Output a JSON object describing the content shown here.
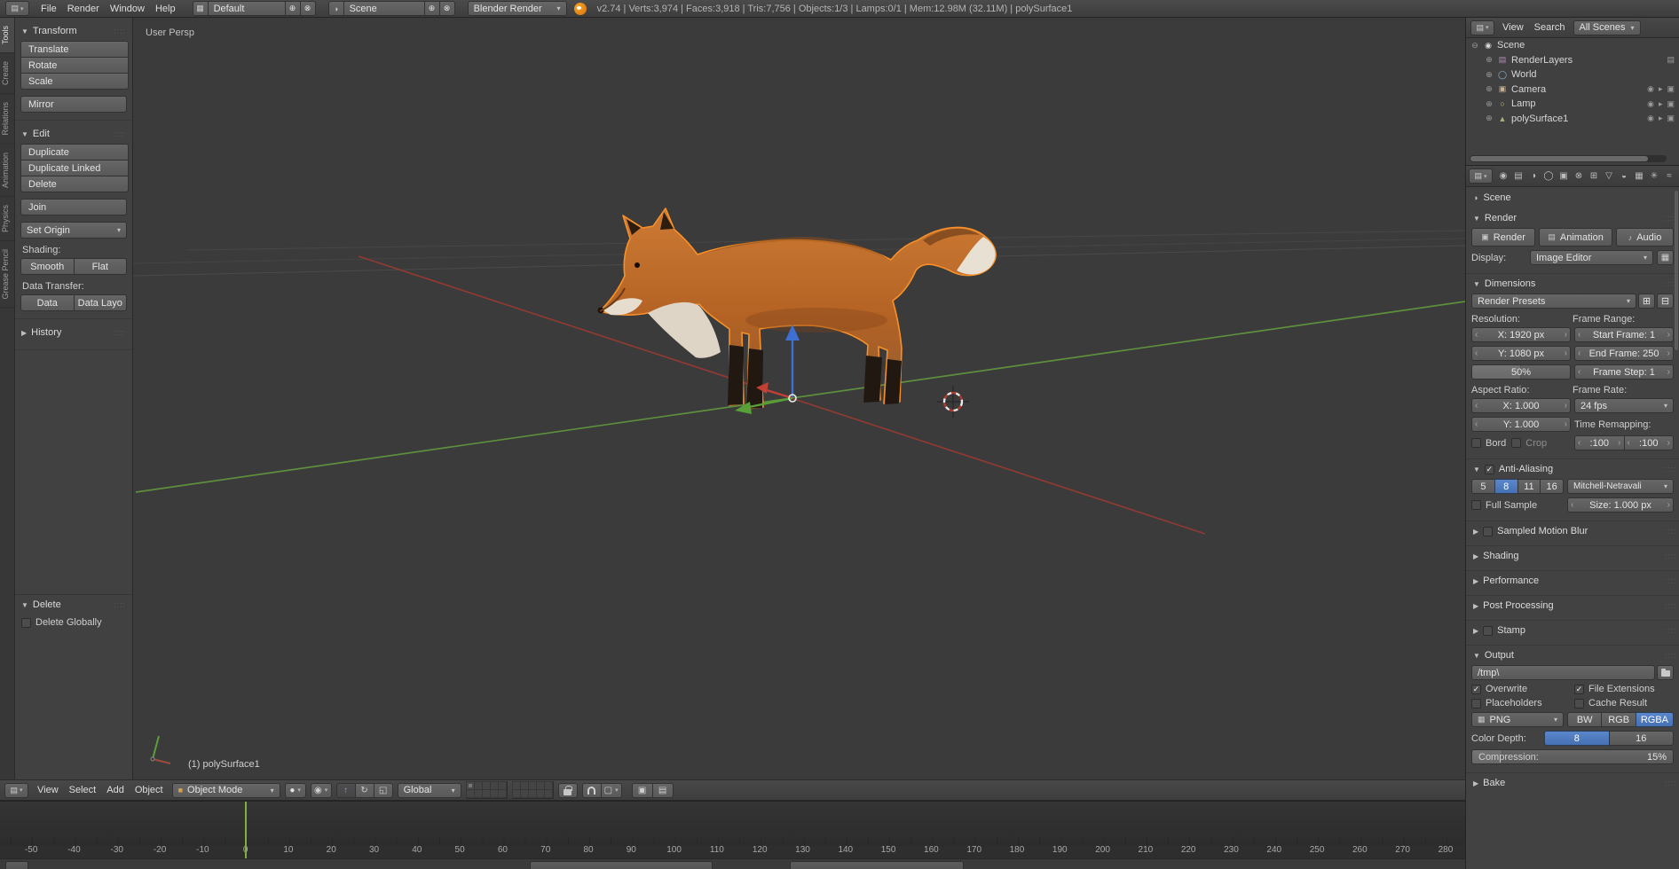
{
  "top_header": {
    "menus": [
      "File",
      "Render",
      "Window",
      "Help"
    ],
    "screen_layout": "Default",
    "scene_name": "Scene",
    "engine": "Blender Render",
    "stats": "v2.74 | Verts:3,974 | Faces:3,918 | Tris:7,756 | Objects:1/3 | Lamps:0/1 | Mem:12.98M (32.11M) | polySurface1"
  },
  "tool_shelf": {
    "tabs": [
      "Tools",
      "Create",
      "Relations",
      "Animation",
      "Physics",
      "Grease Pencil"
    ],
    "transform_title": "Transform",
    "transform_buttons": [
      "Translate",
      "Rotate",
      "Scale"
    ],
    "mirror": "Mirror",
    "edit_title": "Edit",
    "edit_buttons": [
      "Duplicate",
      "Duplicate Linked",
      "Delete"
    ],
    "join": "Join",
    "set_origin": "Set Origin",
    "shading_label": "Shading:",
    "smooth": "Smooth",
    "flat": "Flat",
    "data_transfer_label": "Data Transfer:",
    "data": "Data",
    "data_layout": "Data Layo",
    "history_title": "History",
    "operator_title": "Delete",
    "operator_option": "Delete Globally"
  },
  "viewport": {
    "view_label": "User Persp",
    "status_label": "(1) polySurface1"
  },
  "viewport_header": {
    "menus": [
      "View",
      "Select",
      "Add",
      "Object"
    ],
    "mode": "Object Mode",
    "orientation": "Global"
  },
  "timeline": {
    "ticks": [
      "-50",
      "-40",
      "-30",
      "-20",
      "-10",
      "0",
      "10",
      "20",
      "30",
      "40",
      "50",
      "60",
      "70",
      "80",
      "90",
      "100",
      "110",
      "120",
      "130",
      "140",
      "150",
      "160",
      "170",
      "180",
      "190",
      "200",
      "210",
      "220",
      "230",
      "240",
      "250",
      "260",
      "270",
      "280"
    ],
    "current_frame": 0
  },
  "outliner": {
    "menus": [
      "View",
      "Search"
    ],
    "display_filter": "All Scenes",
    "tree": [
      {
        "label": "Scene"
      },
      {
        "label": "RenderLayers"
      },
      {
        "label": "World"
      },
      {
        "label": "Camera"
      },
      {
        "label": "Lamp"
      },
      {
        "label": "polySurface1"
      }
    ]
  },
  "properties": {
    "context_name": "Scene",
    "render_title": "Render",
    "render_button": "Render",
    "animation_button": "Animation",
    "audio_button": "Audio",
    "display_label": "Display:",
    "display_value": "Image Editor",
    "dimensions_title": "Dimensions",
    "render_presets": "Render Presets",
    "resolution_label": "Resolution:",
    "frame_range_label": "Frame Range:",
    "res_x": "X: 1920 px",
    "res_y": "Y: 1080 px",
    "res_scale": "50%",
    "start_frame": "Start Frame: 1",
    "end_frame": "End Frame: 250",
    "frame_step": "Frame Step: 1",
    "aspect_label": "Aspect Ratio:",
    "frame_rate_label": "Frame Rate:",
    "aspect_x": "X: 1.000",
    "aspect_y": "Y: 1.000",
    "fps": "24 fps",
    "time_remap_label": "Time Remapping:",
    "remap_old": ":100",
    "remap_new": ":100",
    "border": "Bord",
    "crop": "Crop",
    "aa_title": "Anti-Aliasing",
    "aa_samples": [
      "5",
      "8",
      "11",
      "16"
    ],
    "aa_filter": "Mitchell-Netravali",
    "full_sample": "Full Sample",
    "aa_size": "Size: 1.000 px",
    "motion_blur_title": "Sampled Motion Blur",
    "shading_title": "Shading",
    "performance_title": "Performance",
    "post_processing_title": "Post Processing",
    "stamp_title": "Stamp",
    "output_title": "Output",
    "output_path": "/tmp\\",
    "overwrite": "Overwrite",
    "file_extensions": "File Extensions",
    "placeholders": "Placeholders",
    "cache_result": "Cache Result",
    "file_format": "PNG",
    "channels": [
      "BW",
      "RGB",
      "RGBA"
    ],
    "color_depth_label": "Color Depth:",
    "color_depths": [
      "8",
      "16"
    ],
    "compression_label": "Compression:",
    "compression_value": "15%",
    "bake_title": "Bake"
  },
  "colors": {
    "accent_blue": "#4671b4",
    "selection_orange": "#f79028",
    "axis_green": "#5d8f3d",
    "axis_red": "#8f3a33",
    "current_frame_green": "#7fae43"
  },
  "icons": {
    "blender-logo": "orange-circle",
    "editor-type": "▤",
    "dropdown-caret": "▾",
    "panel-open": "▼",
    "panel-closed": "▶",
    "checkbox-check": "✓",
    "add": "⊕",
    "remove": "⊗",
    "expand": "⊕",
    "collapse": "⊖"
  }
}
